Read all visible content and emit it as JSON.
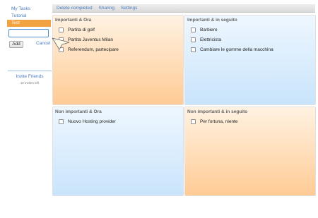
{
  "sidebar": {
    "lists": [
      {
        "label": "My Tasks",
        "selected": false
      },
      {
        "label": "Tutorial",
        "selected": false
      },
      {
        "label": "Test",
        "selected": true
      }
    ],
    "new_list_value": "",
    "add_label": "Add",
    "cancel_label": "Cancel",
    "invite_label": "Invite Friends",
    "invites_left": "10 invites left"
  },
  "toolbar": {
    "delete_completed": "Delete completed",
    "sharing": "Sharing",
    "settings": "Settings"
  },
  "quadrants": {
    "urgent_important": {
      "title": "Importanti & Ora",
      "tasks": [
        "Partita di golf",
        "Partita Juventus Milan",
        "Referendum, partecipare"
      ]
    },
    "important_later": {
      "title": "Importanti & in seguito",
      "tasks": [
        "Barbiere",
        "Elettricista",
        "Cambiare le gomme della macchina"
      ]
    },
    "not_important_now": {
      "title": "Non importanti & Ora",
      "tasks": [
        "Nuovo Hosting provider"
      ]
    },
    "not_important_later": {
      "title": "Non importanti & in seguito",
      "tasks": [
        "Per fortuna, niente"
      ]
    }
  },
  "colors": {
    "accent": "#f0a340",
    "link": "#4a7bbf",
    "orange_quadrant": "#ffcb95",
    "blue_quadrant": "#c9e4fb"
  },
  "icons": {
    "drag_cursor": "pointer-arrow-icon"
  }
}
